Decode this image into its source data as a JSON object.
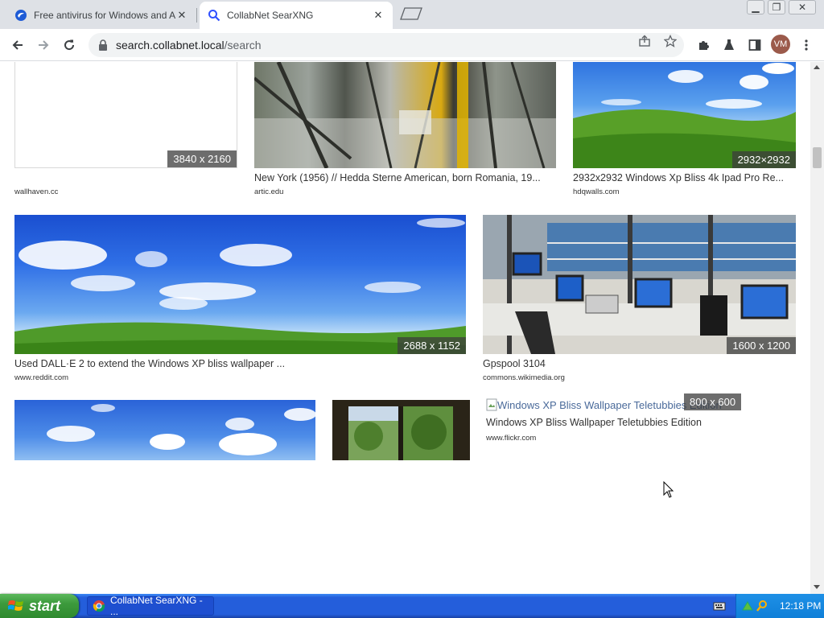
{
  "browser": {
    "tabs": [
      {
        "title": "Free antivirus for Windows and Android",
        "active": false
      },
      {
        "title": "CollabNet SearXNG",
        "active": true
      }
    ],
    "url_host": "search.collabnet.local",
    "url_path": "/search",
    "profile_initials": "VM"
  },
  "results": {
    "row1": [
      {
        "resolution": "3840 x 2160",
        "title": "",
        "source": "wallhaven.cc"
      },
      {
        "resolution": "",
        "title": "New York (1956) // Hedda Sterne American, born Romania, 19...",
        "source": "artic.edu"
      },
      {
        "resolution": "2932×2932",
        "title": "2932x2932 Windows Xp Bliss 4k Ipad Pro Re...",
        "source": "hdqwalls.com"
      }
    ],
    "row2": [
      {
        "resolution": "2688 x 1152",
        "title": "Used DALL·E 2 to extend the Windows XP bliss wallpaper ...",
        "source": "www.reddit.com"
      },
      {
        "resolution": "1600 x 1200",
        "title": "Gpspool 3104",
        "source": "commons.wikimedia.org"
      }
    ],
    "row3": [
      {
        "resolution": "",
        "title": "",
        "source": ""
      },
      {
        "resolution": "",
        "title": "",
        "source": ""
      },
      {
        "resolution": "800 x 600",
        "alt": "Windows XP Bliss Wallpaper Teletubbies Edition",
        "title": "Windows XP Bliss Wallpaper Teletubbies Edition",
        "source": "www.flickr.com"
      }
    ]
  },
  "taskbar": {
    "start_label": "start",
    "task_label": "CollabNet SearXNG - ...",
    "clock": "12:18 PM"
  },
  "colors": {
    "taskbar_blue": "#245edb",
    "start_green": "#3c9a3c",
    "tray_blue": "#0f7fd8"
  }
}
